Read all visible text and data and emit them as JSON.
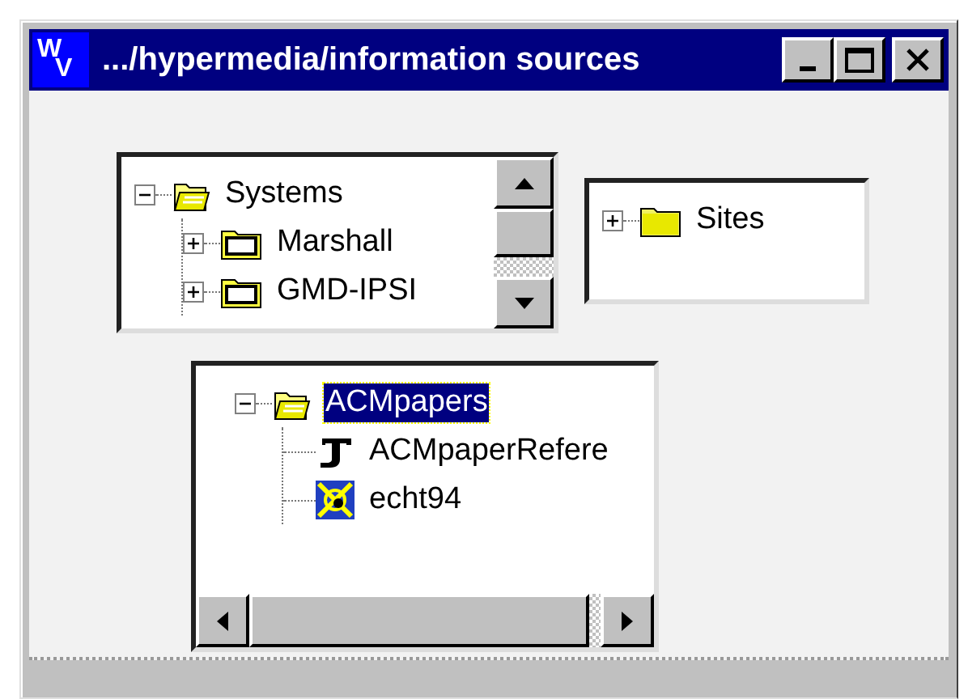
{
  "window": {
    "logo": [
      "W",
      "V"
    ],
    "title": ".../hypermedia/information sources"
  },
  "trees": [
    {
      "vertical_scrollbar": true,
      "horizontal_scrollbar": false,
      "items": [
        {
          "label": "Systems",
          "kind": "open-folder",
          "expanded": true,
          "selected": false,
          "children": [
            {
              "label": "Marshall",
              "kind": "folder",
              "expanded": false,
              "selected": false
            },
            {
              "label": "GMD-IPSI",
              "kind": "folder",
              "expanded": false,
              "selected": false
            }
          ]
        }
      ]
    },
    {
      "vertical_scrollbar": false,
      "horizontal_scrollbar": false,
      "items": [
        {
          "label": "Sites",
          "kind": "closed-folder",
          "expanded": false,
          "selected": false
        }
      ]
    },
    {
      "vertical_scrollbar": false,
      "horizontal_scrollbar": true,
      "items": [
        {
          "label": "ACMpapers",
          "kind": "open-folder",
          "expanded": true,
          "selected": true,
          "children": [
            {
              "label": "ACMpaperRefere",
              "kind": "text",
              "selected": false
            },
            {
              "label": "echt94",
              "kind": "web",
              "selected": false
            }
          ]
        }
      ]
    }
  ]
}
